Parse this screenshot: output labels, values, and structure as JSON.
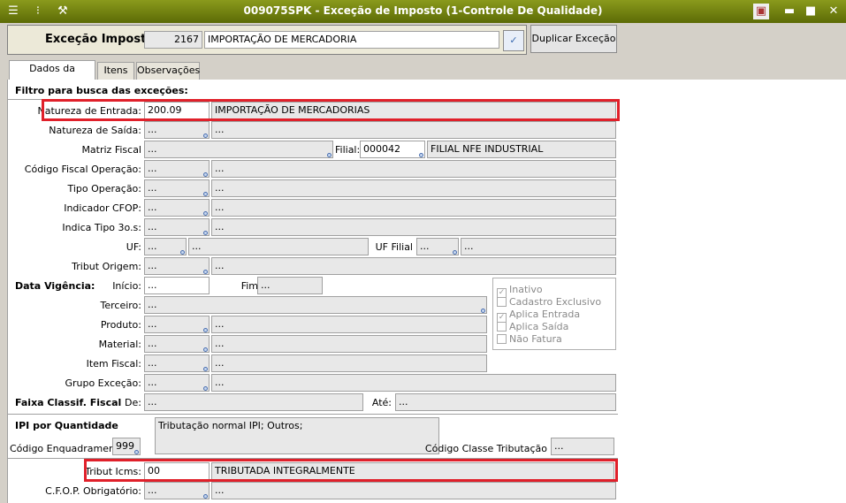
{
  "window": {
    "title": "009075SPK - Exceção de Imposto (1-Controle De Qualidade)",
    "controls": {
      "minimize": "▬",
      "maximize": "■",
      "close": "✕"
    }
  },
  "header": {
    "label": "Exceção Imposto",
    "code": "2167",
    "description": "IMPORTAÇÃO DE MERCADORIA",
    "confirm_glyph": "✓",
    "duplicate_label": "Duplicar Exceção"
  },
  "tabs": [
    "Dados da Exceção",
    "Itens",
    "Observações"
  ],
  "form": {
    "section_title": "Filtro para busca das exceções:",
    "natureza_entrada": {
      "label": "Natureza de Entrada:",
      "code": "200.09",
      "desc": "IMPORTAÇÃO DE MERCADORIAS"
    },
    "natureza_saida": {
      "label": "Natureza de Saída:",
      "code": "...",
      "desc": "..."
    },
    "matriz_fiscal": {
      "label": "Matriz Fiscal",
      "value": "..."
    },
    "filial": {
      "label": "Filial:",
      "code": "000042",
      "desc": "FILIAL NFE INDUSTRIAL"
    },
    "codigo_fiscal": {
      "label": "Código Fiscal Operação:",
      "code": "...",
      "desc": "..."
    },
    "tipo_operacao": {
      "label": "Tipo Operação:",
      "code": "...",
      "desc": "..."
    },
    "indicador_cfop": {
      "label": "Indicador CFOP:",
      "code": "...",
      "desc": "..."
    },
    "indica_tipo": {
      "label": "Indica Tipo 3o.s:",
      "code": "...",
      "desc": "..."
    },
    "uf": {
      "label": "UF:",
      "code": "...",
      "desc": "..."
    },
    "uf_filial": {
      "label": "UF Filial",
      "code": "...",
      "desc": "..."
    },
    "tribut_origem": {
      "label": "Tribut Origem:",
      "code": "...",
      "desc": "..."
    },
    "data_vigencia": {
      "label": "Data Vigência:",
      "inicio_label": "Início:",
      "inicio": "...",
      "fim_label": "Fim",
      "fim": "..."
    },
    "terceiro": {
      "label": "Terceiro:",
      "value": "..."
    },
    "produto": {
      "label": "Produto:",
      "code": "...",
      "desc": "..."
    },
    "material": {
      "label": "Material:",
      "code": "...",
      "desc": "..."
    },
    "item_fiscal": {
      "label": "Item Fiscal:",
      "code": "...",
      "desc": "..."
    },
    "grupo_excecao": {
      "label": "Grupo Exceção:",
      "code": "...",
      "desc": "..."
    },
    "faixa": {
      "label": "Faixa Classif. Fiscal",
      "de_label": "De:",
      "de": "...",
      "ate_label": "Até:",
      "ate": "..."
    },
    "checkboxes": [
      {
        "label": "Inativo",
        "checked": true
      },
      {
        "label": "Cadastro Exclusivo",
        "checked": false
      },
      {
        "label": "Aplica Entrada",
        "checked": true
      },
      {
        "label": "Aplica Saída",
        "checked": false
      },
      {
        "label": "Não Fatura",
        "checked": false
      }
    ],
    "check_glyph": "✓"
  },
  "ipi": {
    "title": "IPI por Quantidade",
    "codigo_enq_label": "Código Enquadramento",
    "codigo_enq": "999",
    "tributacao_text": "Tributação normal IPI; Outros;",
    "classe_label": "Código Classe Tributação",
    "classe_value": "..."
  },
  "icms": {
    "tribut_label": "Tribut Icms:",
    "tribut_code": "00",
    "tribut_desc": "TRIBUTADA INTEGRALMENTE",
    "cfop_label": "C.F.O.P. Obrigatório:",
    "cfop_code": "...",
    "cfop_desc": "..."
  },
  "icons": {
    "menu": "menu-icon",
    "traffic": "traffic-light-icon",
    "wrench": "wrench-icon",
    "picture": "image-icon"
  },
  "colors": {
    "title_bar": "#6f7e10",
    "highlight": "#e0202a"
  }
}
